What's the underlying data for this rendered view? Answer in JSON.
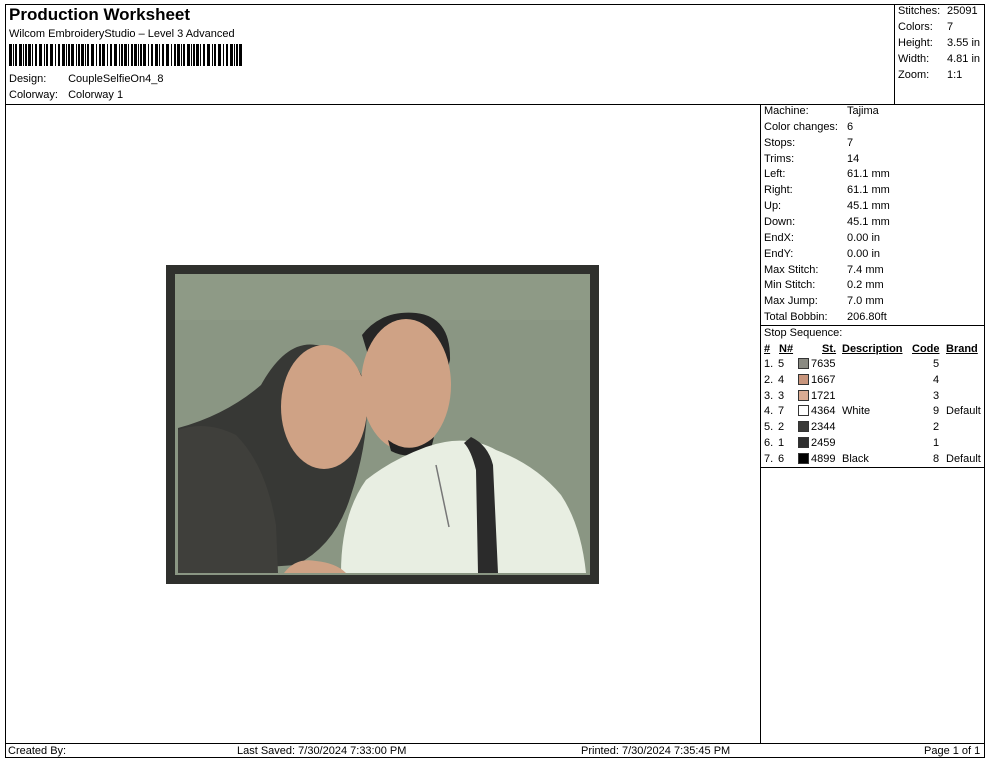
{
  "header": {
    "title": "Production Worksheet",
    "subtitle": "Wilcom EmbroideryStudio – Level 3 Advanced",
    "design_label": "Design:",
    "design_value": "CoupleSelfieOn4_8",
    "colorway_label": "Colorway:",
    "colorway_value": "Colorway 1"
  },
  "stats": [
    {
      "label": "Stitches:",
      "value": "25091"
    },
    {
      "label": "Colors:",
      "value": "7"
    },
    {
      "label": "Height:",
      "value": "3.55 in"
    },
    {
      "label": "Width:",
      "value": "4.81 in"
    },
    {
      "label": "Zoom:",
      "value": "1:1"
    }
  ],
  "machine_info": [
    {
      "label": "Machine:",
      "value": "Tajima"
    },
    {
      "label": "Color changes:",
      "value": "6"
    },
    {
      "label": "Stops:",
      "value": "7"
    },
    {
      "label": "Trims:",
      "value": "14"
    },
    {
      "label": "Left:",
      "value": "61.1 mm"
    },
    {
      "label": "Right:",
      "value": "61.1 mm"
    },
    {
      "label": "Up:",
      "value": "45.1 mm"
    },
    {
      "label": "Down:",
      "value": "45.1 mm"
    },
    {
      "label": "EndX:",
      "value": "0.00 in"
    },
    {
      "label": "EndY:",
      "value": "0.00 in"
    },
    {
      "label": "Max Stitch:",
      "value": "7.4 mm"
    },
    {
      "label": "Min Stitch:",
      "value": "0.2 mm"
    },
    {
      "label": "Max Jump:",
      "value": "7.0 mm"
    },
    {
      "label": "Total Bobbin:",
      "value": "206.80ft"
    }
  ],
  "stop_sequence": {
    "title": "Stop Sequence:",
    "columns": {
      "num": "#",
      "n": "N#",
      "st": "St.",
      "description": "Description",
      "code": "Code",
      "brand": "Brand"
    },
    "rows": [
      {
        "num": "1.",
        "n": "5",
        "color": "#8a8a82",
        "st": "7635",
        "description": "",
        "code": "5",
        "brand": ""
      },
      {
        "num": "2.",
        "n": "4",
        "color": "#c8957c",
        "st": "1667",
        "description": "",
        "code": "4",
        "brand": ""
      },
      {
        "num": "3.",
        "n": "3",
        "color": "#d9ab93",
        "st": "1721",
        "description": "",
        "code": "3",
        "brand": ""
      },
      {
        "num": "4.",
        "n": "7",
        "color": "#ffffff",
        "st": "4364",
        "description": "White",
        "code": "9",
        "brand": "Default"
      },
      {
        "num": "5.",
        "n": "2",
        "color": "#3a3a38",
        "st": "2344",
        "description": "",
        "code": "2",
        "brand": ""
      },
      {
        "num": "6.",
        "n": "1",
        "color": "#2e2e2e",
        "st": "2459",
        "description": "",
        "code": "1",
        "brand": ""
      },
      {
        "num": "7.",
        "n": "6",
        "color": "#000000",
        "st": "4899",
        "description": "Black",
        "code": "8",
        "brand": "Default"
      }
    ]
  },
  "footer": {
    "created_by": "Created By:",
    "last_saved": "Last Saved: 7/30/2024 7:33:00 PM",
    "printed": "Printed: 7/30/2024 7:35:45 PM",
    "page": "Page 1 of 1"
  },
  "colors": {
    "background": "#8a9683",
    "frame": "#2f302d",
    "skin": "#cfa285",
    "hair": "#2a2a2a",
    "shirt": "#e8eee2"
  }
}
